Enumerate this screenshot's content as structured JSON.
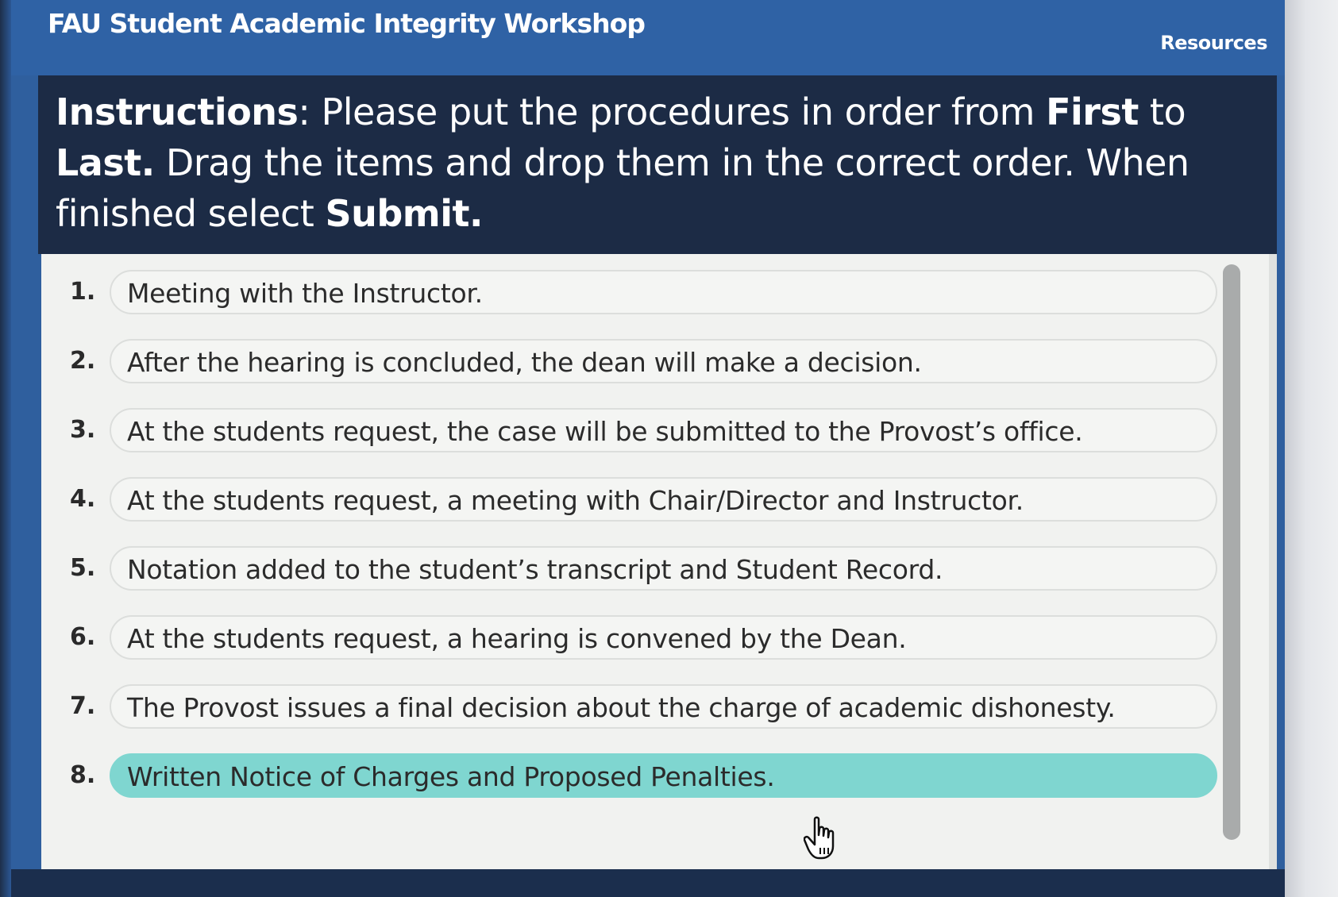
{
  "header": {
    "app_title": "FAU Student Academic Integrity Workshop",
    "resources_label": "Resources"
  },
  "instructions": {
    "prefix": "Instructions",
    "part1": ": Please put the procedures in order from ",
    "first": "First",
    "to": " to ",
    "last": "Last.",
    "part2": " Drag the items and drop them in the correct order. When finished select ",
    "submit": "Submit."
  },
  "items": [
    {
      "number": "1.",
      "text": "Meeting with the Instructor."
    },
    {
      "number": "2.",
      "text": "After the hearing is concluded, the dean will make a decision."
    },
    {
      "number": "3.",
      "text": "At the students request, the case will be submitted to the Provost’s office."
    },
    {
      "number": "4.",
      "text": "At the students request, a meeting with Chair/Director and Instructor."
    },
    {
      "number": "5.",
      "text": "Notation added to the student’s transcript and Student Record."
    },
    {
      "number": "6.",
      "text": "At the students request, a hearing is convened by the Dean."
    },
    {
      "number": "7.",
      "text": "The Provost issues a final decision about the charge of academic dishonesty."
    },
    {
      "number": "8.",
      "text": "Written Notice of Charges and Proposed Penalties."
    }
  ],
  "colors": {
    "header_bg": "#2f62a5",
    "instructions_bg": "#1c2b45",
    "selected_item": "#7fd6d0"
  },
  "icons": {
    "cursor": "hand-pointer-icon"
  }
}
